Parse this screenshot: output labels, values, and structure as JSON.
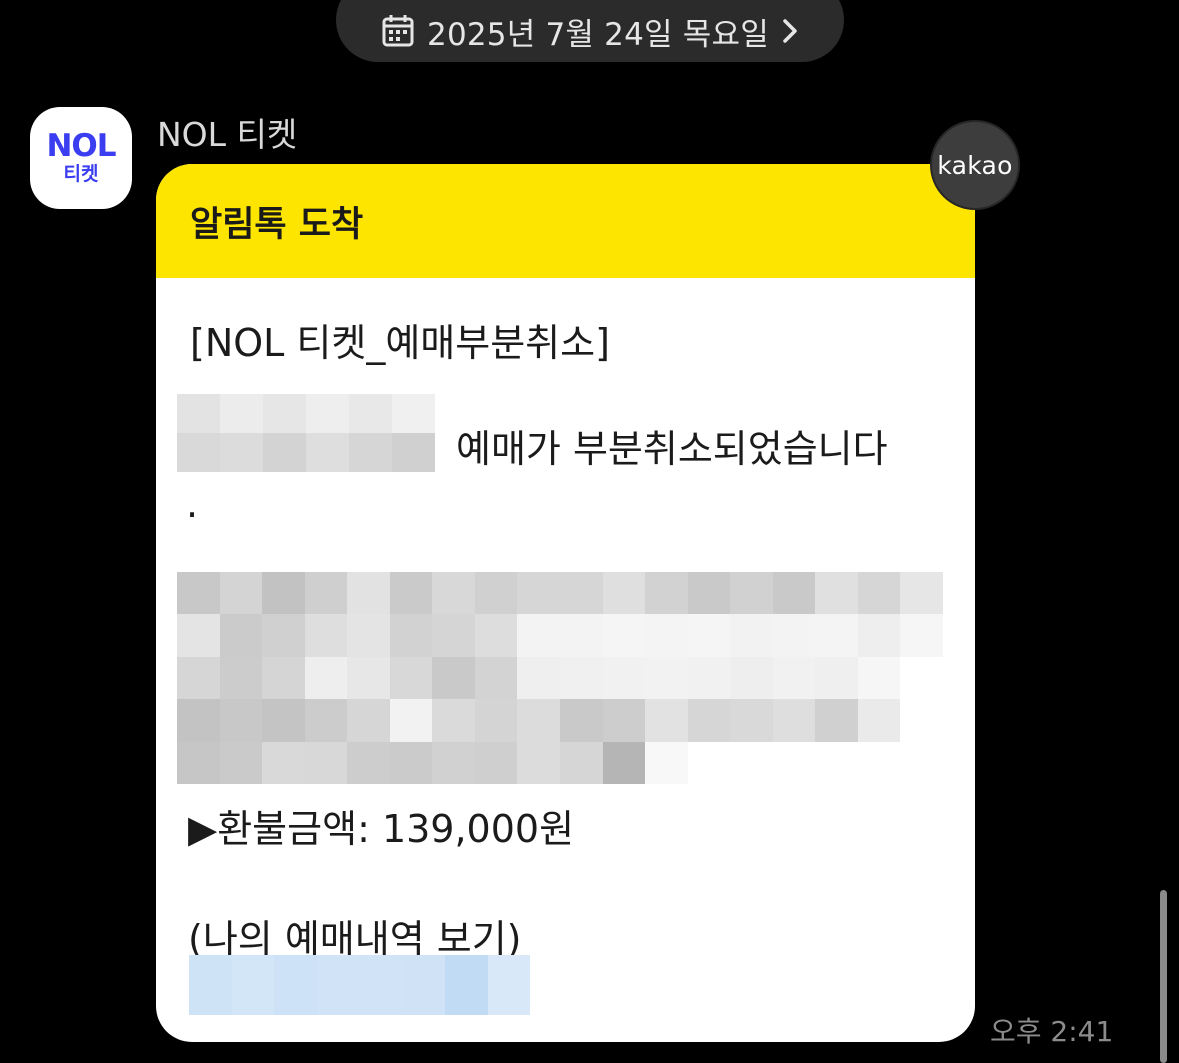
{
  "date_header": {
    "text": "2025년 7월 24일 목요일"
  },
  "sender": {
    "name": "NOL 티켓",
    "logo_main": "NOL",
    "logo_sub": "티켓"
  },
  "message": {
    "header": "알림톡 도착",
    "title": "[NOL 티켓_예매부분취소]",
    "line1": "예매가 부분취소되었습니다",
    "line1_tail": ".",
    "refund": "▶환불금액: 139,000원",
    "history_label": "(나의 예매내역 보기)"
  },
  "badge": {
    "text": "kakao"
  },
  "timestamp": "오후 2:41",
  "colors": {
    "background": "#000000",
    "header_yellow": "#fee500",
    "bubble": "#ffffff",
    "logo_blue": "#3a3df0"
  }
}
